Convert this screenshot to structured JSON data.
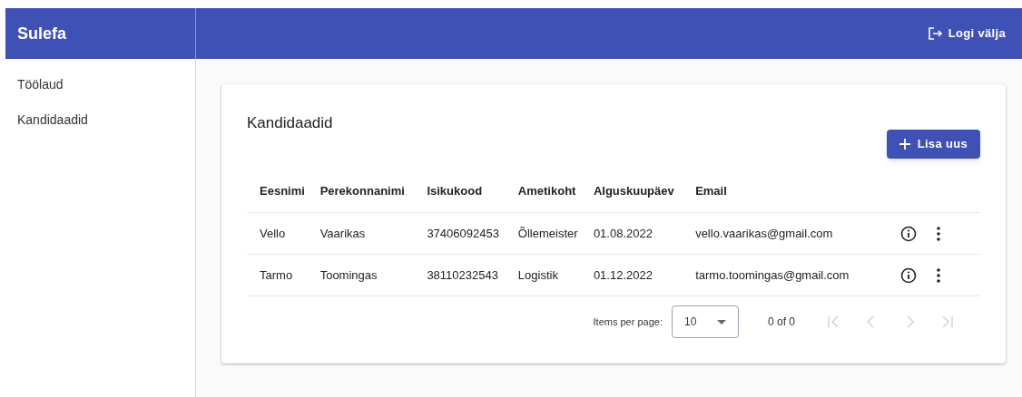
{
  "app_title": "Sulefa",
  "logout": {
    "label": "Logi välja"
  },
  "sidebar": {
    "items": [
      {
        "label": "Töölaud"
      },
      {
        "label": "Kandidaadid"
      }
    ]
  },
  "card": {
    "title": "Kandidaadid",
    "add_button": "Lisa uus"
  },
  "table": {
    "columns": [
      "Eesnimi",
      "Perekonnanimi",
      "Isikukood",
      "Ametikoht",
      "Alguskuupäev",
      "Email"
    ],
    "rows": [
      {
        "cells": [
          "Vello",
          "Vaarikas",
          "37406092453",
          "Õllemeister",
          "01.08.2022",
          "vello.vaarikas@gmail.com"
        ]
      },
      {
        "cells": [
          "Tarmo",
          "Toomingas",
          "38110232543",
          "Logistik",
          "01.12.2022",
          "tarmo.toomingas@gmail.com"
        ]
      }
    ]
  },
  "paginator": {
    "label": "Items per page:",
    "page_size": "10",
    "range": "0 of 0",
    "first_disabled": true,
    "prev_disabled": true,
    "next_disabled": true,
    "last_disabled": true
  }
}
